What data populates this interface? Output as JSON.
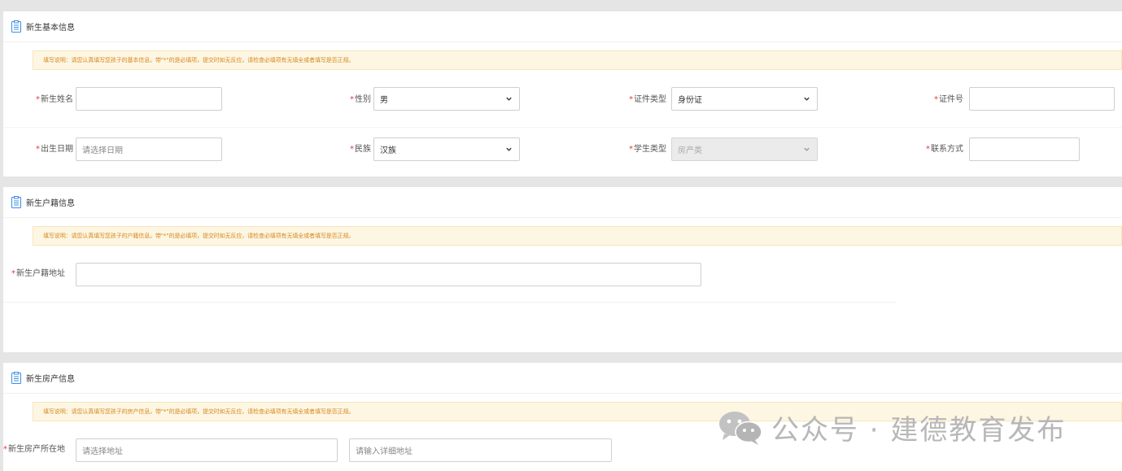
{
  "sections": {
    "basic": {
      "title": "新生基本信息",
      "notice": "填写说明：请您认真填写您孩子的基本信息。带\"*\"的是必填项，提交时如无反应，请检查必填项有无填全或者填写是否正规。",
      "fields": {
        "name": {
          "label": "新生姓名",
          "value": ""
        },
        "gender": {
          "label": "性别",
          "value": "男"
        },
        "id_type": {
          "label": "证件类型",
          "value": "身份证"
        },
        "id_number": {
          "label": "证件号",
          "value": ""
        },
        "birth_date": {
          "label": "出生日期",
          "placeholder": "请选择日期"
        },
        "ethnicity": {
          "label": "民族",
          "value": "汉族"
        },
        "student_type": {
          "label": "学生类型",
          "value": "房产类"
        },
        "contact": {
          "label": "联系方式",
          "value": ""
        }
      }
    },
    "huji": {
      "title": "新生户籍信息",
      "notice": "填写说明：请您认真填写您孩子的户籍信息。带\"*\"的是必填项，提交时如无反应，请检查必填项有无填全或者填写是否正规。",
      "fields": {
        "address": {
          "label": "新生户籍地址",
          "value": ""
        }
      }
    },
    "house": {
      "title": "新生房产信息",
      "notice": "填写说明：请您认真填写您孩子的房产信息。带\"*\"的是必填项，提交时如无反应，请检查必填项有无填全或者填写是否正规。",
      "fields": {
        "location": {
          "label": "新生房产所在地",
          "placeholder_area": "请选择地址",
          "placeholder_detail": "请输入详细地址"
        }
      }
    }
  },
  "required_mark": "*",
  "watermark": "公众号 · 建德教育发布",
  "colors": {
    "required": "#e4393c",
    "notice_text": "#d68a1f",
    "notice_bg": "#fdf6e3",
    "icon_blue": "#3a8ee6"
  },
  "icons": [
    "document-icon",
    "chevron-down-icon",
    "wechat-icon"
  ]
}
